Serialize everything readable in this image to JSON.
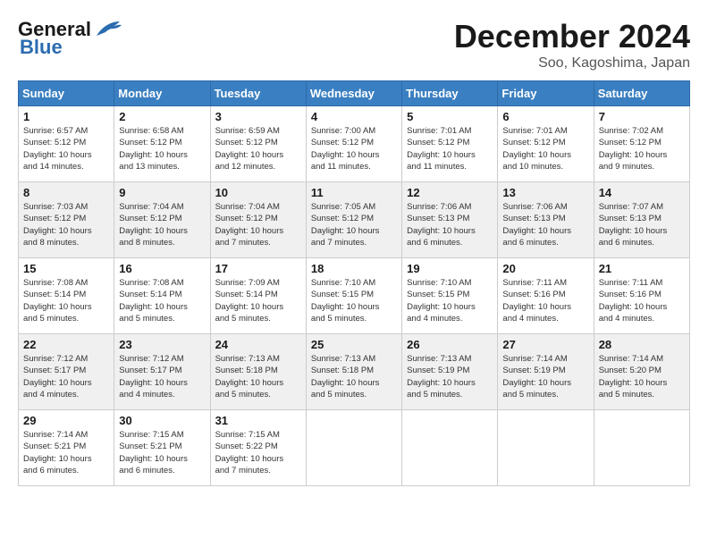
{
  "header": {
    "logo_line1": "General",
    "logo_line2": "Blue",
    "month": "December 2024",
    "location": "Soo, Kagoshima, Japan"
  },
  "weekdays": [
    "Sunday",
    "Monday",
    "Tuesday",
    "Wednesday",
    "Thursday",
    "Friday",
    "Saturday"
  ],
  "weeks": [
    [
      {
        "day": 1,
        "info": "Sunrise: 6:57 AM\nSunset: 5:12 PM\nDaylight: 10 hours\nand 14 minutes."
      },
      {
        "day": 2,
        "info": "Sunrise: 6:58 AM\nSunset: 5:12 PM\nDaylight: 10 hours\nand 13 minutes."
      },
      {
        "day": 3,
        "info": "Sunrise: 6:59 AM\nSunset: 5:12 PM\nDaylight: 10 hours\nand 12 minutes."
      },
      {
        "day": 4,
        "info": "Sunrise: 7:00 AM\nSunset: 5:12 PM\nDaylight: 10 hours\nand 11 minutes."
      },
      {
        "day": 5,
        "info": "Sunrise: 7:01 AM\nSunset: 5:12 PM\nDaylight: 10 hours\nand 11 minutes."
      },
      {
        "day": 6,
        "info": "Sunrise: 7:01 AM\nSunset: 5:12 PM\nDaylight: 10 hours\nand 10 minutes."
      },
      {
        "day": 7,
        "info": "Sunrise: 7:02 AM\nSunset: 5:12 PM\nDaylight: 10 hours\nand 9 minutes."
      }
    ],
    [
      {
        "day": 8,
        "info": "Sunrise: 7:03 AM\nSunset: 5:12 PM\nDaylight: 10 hours\nand 8 minutes."
      },
      {
        "day": 9,
        "info": "Sunrise: 7:04 AM\nSunset: 5:12 PM\nDaylight: 10 hours\nand 8 minutes."
      },
      {
        "day": 10,
        "info": "Sunrise: 7:04 AM\nSunset: 5:12 PM\nDaylight: 10 hours\nand 7 minutes."
      },
      {
        "day": 11,
        "info": "Sunrise: 7:05 AM\nSunset: 5:12 PM\nDaylight: 10 hours\nand 7 minutes."
      },
      {
        "day": 12,
        "info": "Sunrise: 7:06 AM\nSunset: 5:13 PM\nDaylight: 10 hours\nand 6 minutes."
      },
      {
        "day": 13,
        "info": "Sunrise: 7:06 AM\nSunset: 5:13 PM\nDaylight: 10 hours\nand 6 minutes."
      },
      {
        "day": 14,
        "info": "Sunrise: 7:07 AM\nSunset: 5:13 PM\nDaylight: 10 hours\nand 6 minutes."
      }
    ],
    [
      {
        "day": 15,
        "info": "Sunrise: 7:08 AM\nSunset: 5:14 PM\nDaylight: 10 hours\nand 5 minutes."
      },
      {
        "day": 16,
        "info": "Sunrise: 7:08 AM\nSunset: 5:14 PM\nDaylight: 10 hours\nand 5 minutes."
      },
      {
        "day": 17,
        "info": "Sunrise: 7:09 AM\nSunset: 5:14 PM\nDaylight: 10 hours\nand 5 minutes."
      },
      {
        "day": 18,
        "info": "Sunrise: 7:10 AM\nSunset: 5:15 PM\nDaylight: 10 hours\nand 5 minutes."
      },
      {
        "day": 19,
        "info": "Sunrise: 7:10 AM\nSunset: 5:15 PM\nDaylight: 10 hours\nand 4 minutes."
      },
      {
        "day": 20,
        "info": "Sunrise: 7:11 AM\nSunset: 5:16 PM\nDaylight: 10 hours\nand 4 minutes."
      },
      {
        "day": 21,
        "info": "Sunrise: 7:11 AM\nSunset: 5:16 PM\nDaylight: 10 hours\nand 4 minutes."
      }
    ],
    [
      {
        "day": 22,
        "info": "Sunrise: 7:12 AM\nSunset: 5:17 PM\nDaylight: 10 hours\nand 4 minutes."
      },
      {
        "day": 23,
        "info": "Sunrise: 7:12 AM\nSunset: 5:17 PM\nDaylight: 10 hours\nand 4 minutes."
      },
      {
        "day": 24,
        "info": "Sunrise: 7:13 AM\nSunset: 5:18 PM\nDaylight: 10 hours\nand 5 minutes."
      },
      {
        "day": 25,
        "info": "Sunrise: 7:13 AM\nSunset: 5:18 PM\nDaylight: 10 hours\nand 5 minutes."
      },
      {
        "day": 26,
        "info": "Sunrise: 7:13 AM\nSunset: 5:19 PM\nDaylight: 10 hours\nand 5 minutes."
      },
      {
        "day": 27,
        "info": "Sunrise: 7:14 AM\nSunset: 5:19 PM\nDaylight: 10 hours\nand 5 minutes."
      },
      {
        "day": 28,
        "info": "Sunrise: 7:14 AM\nSunset: 5:20 PM\nDaylight: 10 hours\nand 5 minutes."
      }
    ],
    [
      {
        "day": 29,
        "info": "Sunrise: 7:14 AM\nSunset: 5:21 PM\nDaylight: 10 hours\nand 6 minutes."
      },
      {
        "day": 30,
        "info": "Sunrise: 7:15 AM\nSunset: 5:21 PM\nDaylight: 10 hours\nand 6 minutes."
      },
      {
        "day": 31,
        "info": "Sunrise: 7:15 AM\nSunset: 5:22 PM\nDaylight: 10 hours\nand 7 minutes."
      },
      null,
      null,
      null,
      null
    ]
  ]
}
